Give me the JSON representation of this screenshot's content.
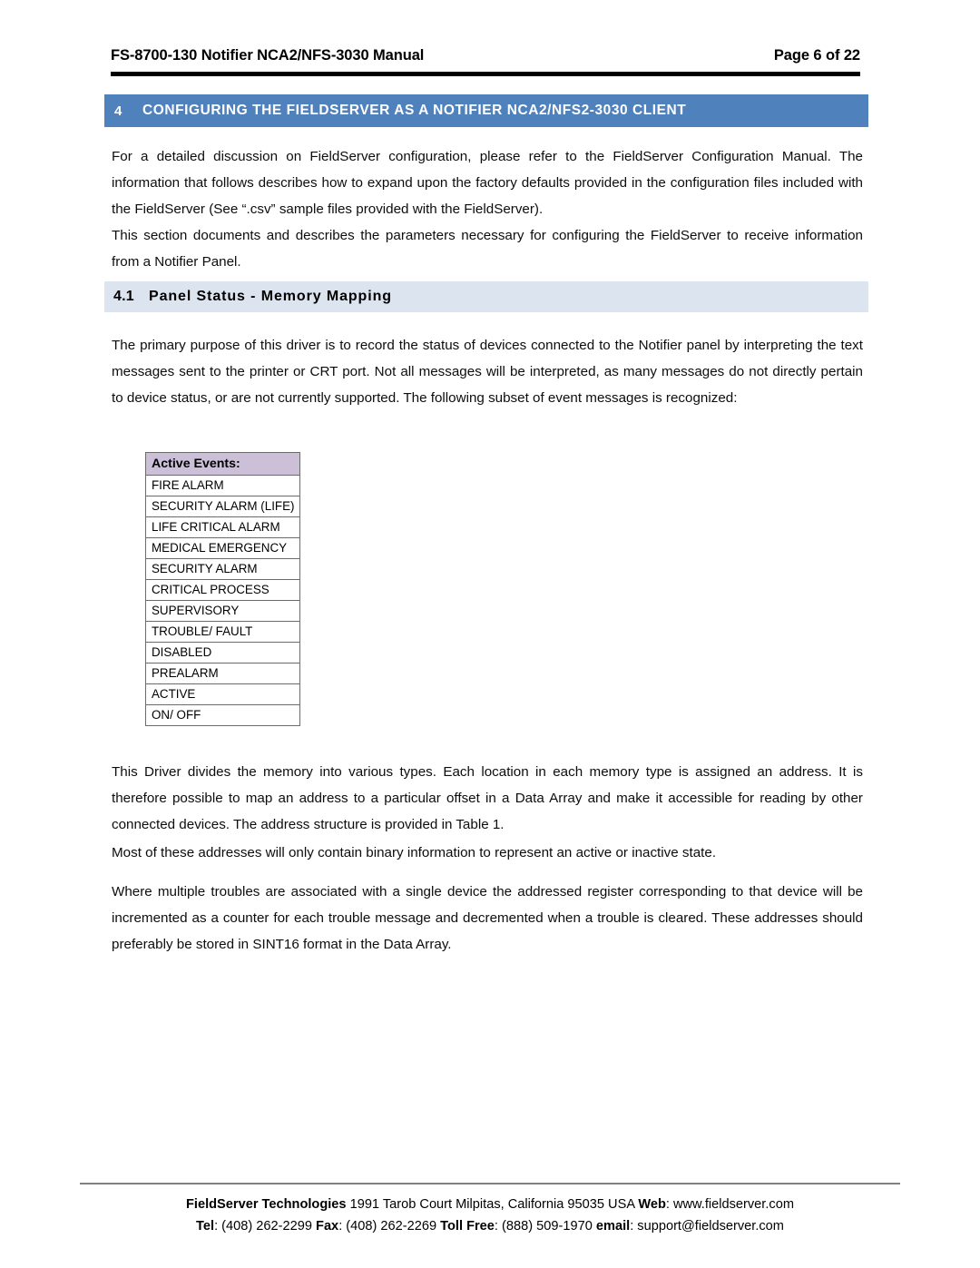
{
  "header": {
    "document_title": "FS-8700-130 Notifier NCA2/NFS-3030 Manual",
    "page_indicator": "Page 6 of 22"
  },
  "section": {
    "number": "4",
    "title": "CONFIGURING THE FIELDSERVER AS A NOTIFIER NCA2/NFS2-3030 CLIENT",
    "bar_color": "#4F81BD",
    "text_color": "#FFFFFF"
  },
  "subsection": {
    "number": "4.1",
    "title": "Panel Status - Memory Mapping",
    "band_color": "#DCE4EF"
  },
  "body": {
    "paragraph_1": "For a detailed discussion on FieldServer configuration, please refer to the FieldServer Configuration Manual.  The information that follows describes how to expand upon the factory defaults provided in the configuration files included with the FieldServer (See “.csv” sample files provided with the FieldServer).",
    "paragraph_2": "This section documents and describes the parameters necessary for configuring the FieldServer to receive information from a Notifier Panel.",
    "paragraph_3": "The primary purpose of this driver is to record the status of devices connected to the Notifier panel by interpreting the text messages sent to the printer or CRT port.  Not all messages will be interpreted, as many messages do not directly pertain to device status, or are not currently supported.  The following subset of event messages is recognized:",
    "paragraph_4": "This Driver divides the memory into various types.  Each location in each memory type is assigned an address.  It is therefore possible to map an address to a particular offset in a Data Array and make it accessible for reading by other connected devices.  The address structure is provided in Table 1.",
    "paragraph_5": "Most of these addresses will only contain binary information to represent an active or inactive state.",
    "paragraph_6": "Where multiple troubles are associated with a single device the addressed register corresponding to that device will be incremented as a counter for each trouble message and decremented when a trouble is cleared.  These addresses should preferably be stored in SINT16 format in the Data Array."
  },
  "events_table": {
    "header": "Active Events:",
    "header_color": "#CCC0D9",
    "rows": [
      "FIRE ALARM",
      "SECURITY ALARM (LIFE)",
      "LIFE CRITICAL ALARM",
      "MEDICAL EMERGENCY",
      "SECURITY ALARM",
      "CRITICAL PROCESS",
      "SUPERVISORY",
      "TROUBLE/ FAULT",
      "DISABLED",
      "PREALARM",
      "ACTIVE",
      "ON/ OFF"
    ]
  },
  "footer": {
    "line1": {
      "company": "FieldServer Technologies",
      "address": " 1991 Tarob Court Milpitas, California 95035 USA  ",
      "web_label": "Web",
      "web_value": ": www.fieldserver.com"
    },
    "line2": {
      "tel_label": "Tel",
      "tel_value": ": (408) 262-2299  ",
      "fax_label": "Fax",
      "fax_value": ": (408) 262-2269  ",
      "tollfree_label": "Toll Free",
      "tollfree_value": ": (888) 509-1970  ",
      "email_label": "email",
      "email_value": ": support@fieldserver.com"
    }
  }
}
